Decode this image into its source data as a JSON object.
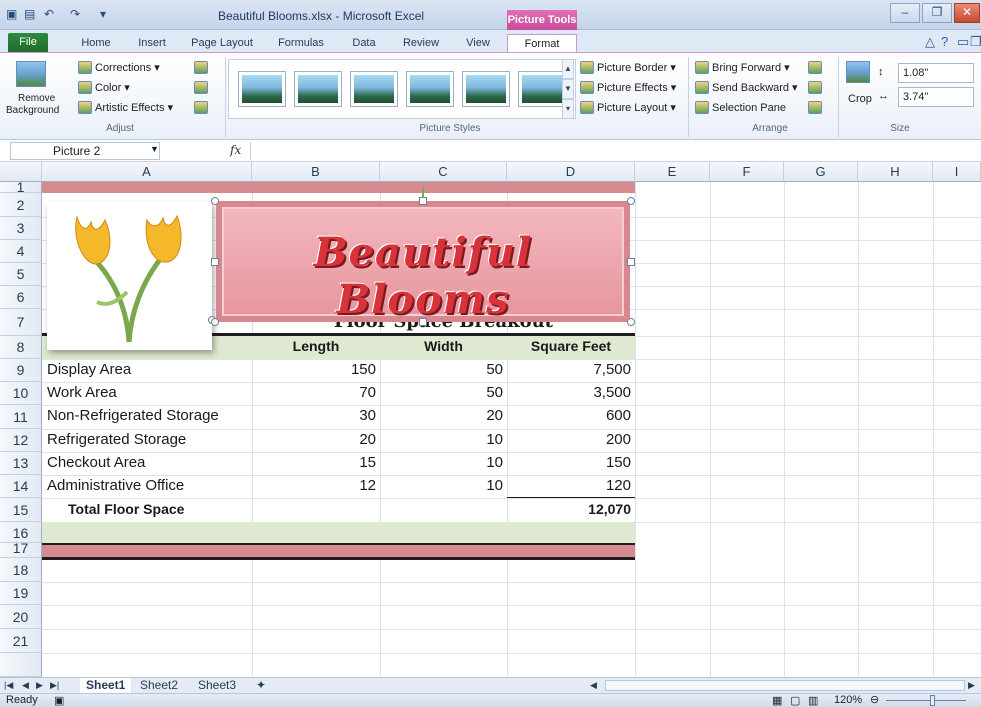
{
  "window": {
    "title": "Beautiful Blooms.xlsx - Microsoft Excel",
    "context_tab": "Picture Tools",
    "controls": [
      "minimize",
      "restore",
      "close"
    ]
  },
  "tabs": [
    "File",
    "Home",
    "Insert",
    "Page Layout",
    "Formulas",
    "Data",
    "Review",
    "View",
    "Format"
  ],
  "active_tab": "Format",
  "ribbon": {
    "adjust": {
      "label": "Adjust",
      "remove_background_line1": "Remove",
      "remove_background_line2": "Background",
      "corrections": "Corrections",
      "color": "Color",
      "artistic_effects": "Artistic Effects"
    },
    "picture_styles": {
      "label": "Picture Styles",
      "picture_border": "Picture Border",
      "picture_effects": "Picture Effects",
      "picture_layout": "Picture Layout"
    },
    "arrange": {
      "label": "Arrange",
      "bring_forward": "Bring Forward",
      "send_backward": "Send Backward",
      "selection_pane": "Selection Pane"
    },
    "size": {
      "label": "Size",
      "crop": "Crop",
      "height": "1.08\"",
      "width": "3.74\""
    }
  },
  "formula_bar": {
    "name_box": "Picture 2",
    "fx": "fx",
    "value": ""
  },
  "columns": [
    "A",
    "B",
    "C",
    "D",
    "E",
    "F",
    "G",
    "H",
    "I"
  ],
  "rows": [
    "1",
    "2",
    "3",
    "4",
    "5",
    "6",
    "7",
    "8",
    "9",
    "10",
    "11",
    "12",
    "13",
    "14",
    "15",
    "16",
    "17",
    "18",
    "19",
    "20",
    "21"
  ],
  "banner_text": "Beautiful Blooms",
  "sheet_title": "Floor Space Breakout",
  "table": {
    "headers": [
      "Length",
      "Width",
      "Square Feet"
    ],
    "rows": [
      {
        "label": "Display Area",
        "length": "150",
        "width": "50",
        "sqft": "7,500"
      },
      {
        "label": "Work Area",
        "length": "70",
        "width": "50",
        "sqft": "3,500"
      },
      {
        "label": "Non-Refrigerated Storage",
        "length": "30",
        "width": "20",
        "sqft": "600"
      },
      {
        "label": "Refrigerated Storage",
        "length": "20",
        "width": "10",
        "sqft": "200"
      },
      {
        "label": "Checkout Area",
        "length": "15",
        "width": "10",
        "sqft": "150"
      },
      {
        "label": "Administrative Office",
        "length": "12",
        "width": "10",
        "sqft": "120"
      }
    ],
    "total_label": "Total Floor Space",
    "total_value": "12,070"
  },
  "sheets": [
    "Sheet1",
    "Sheet2",
    "Sheet3"
  ],
  "active_sheet": "Sheet1",
  "status": {
    "ready": "Ready",
    "zoom": "120%"
  },
  "colors": {
    "band_pink": "#d58a90",
    "band_green": "#dfe8d0",
    "accent_file": "#2f8a3e",
    "picture_tools": "#d45aa8"
  }
}
